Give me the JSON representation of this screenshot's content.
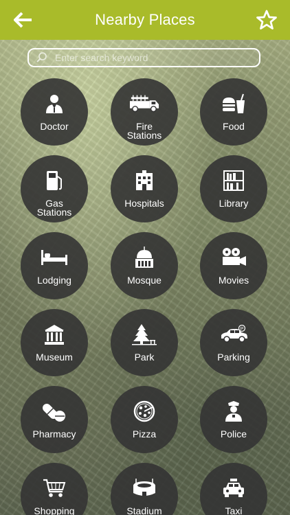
{
  "header": {
    "title": "Nearby Places",
    "color": "#a9bb2a"
  },
  "search": {
    "placeholder": "Enter search keyword",
    "value": ""
  },
  "categories": [
    {
      "label": "Doctor",
      "icon": "doctor-icon"
    },
    {
      "label": "Fire Stations",
      "icon": "fire-truck-icon"
    },
    {
      "label": "Food",
      "icon": "food-icon"
    },
    {
      "label": "Gas Stations",
      "icon": "gas-pump-icon"
    },
    {
      "label": "Hospitals",
      "icon": "hospital-icon"
    },
    {
      "label": "Library",
      "icon": "library-icon"
    },
    {
      "label": "Lodging",
      "icon": "bed-icon"
    },
    {
      "label": "Mosque",
      "icon": "mosque-icon"
    },
    {
      "label": "Movies",
      "icon": "movie-camera-icon"
    },
    {
      "label": "Museum",
      "icon": "museum-icon"
    },
    {
      "label": "Park",
      "icon": "tree-icon"
    },
    {
      "label": "Parking",
      "icon": "car-icon"
    },
    {
      "label": "Pharmacy",
      "icon": "pill-icon"
    },
    {
      "label": "Pizza",
      "icon": "pizza-icon"
    },
    {
      "label": "Police",
      "icon": "police-officer-icon"
    },
    {
      "label": "Shopping",
      "icon": "shopping-cart-icon"
    },
    {
      "label": "Stadium",
      "icon": "stadium-icon"
    },
    {
      "label": "Taxi",
      "icon": "taxi-icon"
    }
  ]
}
